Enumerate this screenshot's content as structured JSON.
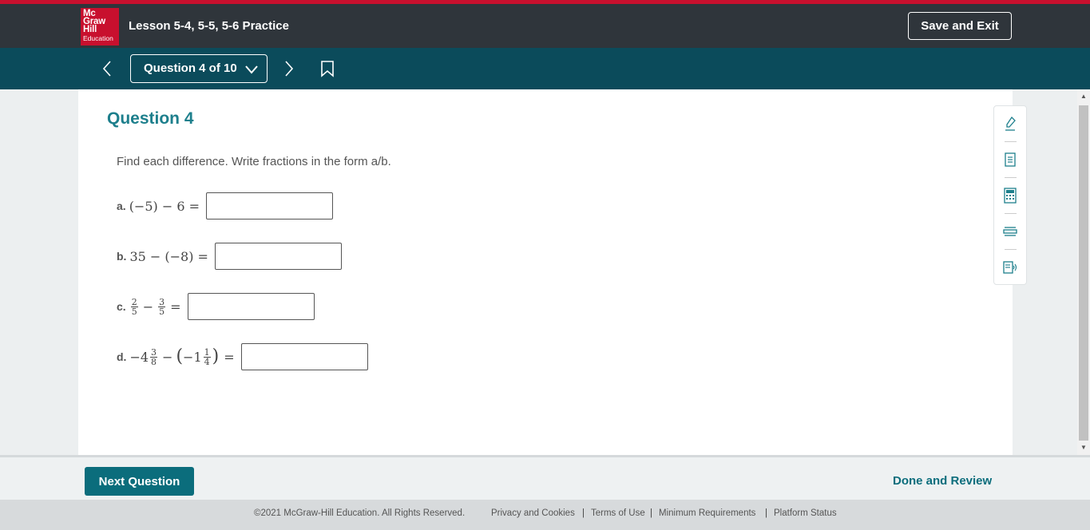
{
  "header": {
    "logo": [
      "Mc",
      "Graw",
      "Hill",
      "Education"
    ],
    "title": "Lesson 5-4, 5-5, 5-6 Practice",
    "save_exit": "Save and Exit"
  },
  "nav": {
    "question_select": "Question 4 of 10"
  },
  "question": {
    "heading": "Question 4",
    "instructions": "Find each difference. Write fractions in the form a/b.",
    "items": [
      {
        "label": "a.",
        "expr": "(−5) − 6 =",
        "value": ""
      },
      {
        "label": "b.",
        "expr": "35 − (−8) =",
        "value": ""
      },
      {
        "label": "c.",
        "expr_parts": [
          "2",
          "5",
          "−",
          "3",
          "5",
          "="
        ],
        "value": ""
      },
      {
        "label": "d.",
        "expr_parts": [
          "−4",
          "3",
          "8",
          "−",
          "(",
          "−1",
          "1",
          "4",
          ")",
          "="
        ],
        "value": ""
      }
    ]
  },
  "tools": [
    "highlighter-icon",
    "notepad-icon",
    "calculator-icon",
    "line-reader-icon",
    "text-to-speech-icon"
  ],
  "footer": {
    "next_question": "Next Question",
    "done_review": "Done and Review"
  },
  "legal": {
    "copyright": "©2021 McGraw-Hill Education. All Rights Reserved.",
    "links": [
      "Privacy and Cookies",
      "Terms of Use",
      "Minimum Requirements",
      "Platform Status"
    ]
  },
  "colors": {
    "brand_red": "#c8102e",
    "topbar": "#2f353b",
    "navbar": "#0b4b5b",
    "accent_teal": "#1d7f8c",
    "button_teal": "#0b6d7c"
  }
}
